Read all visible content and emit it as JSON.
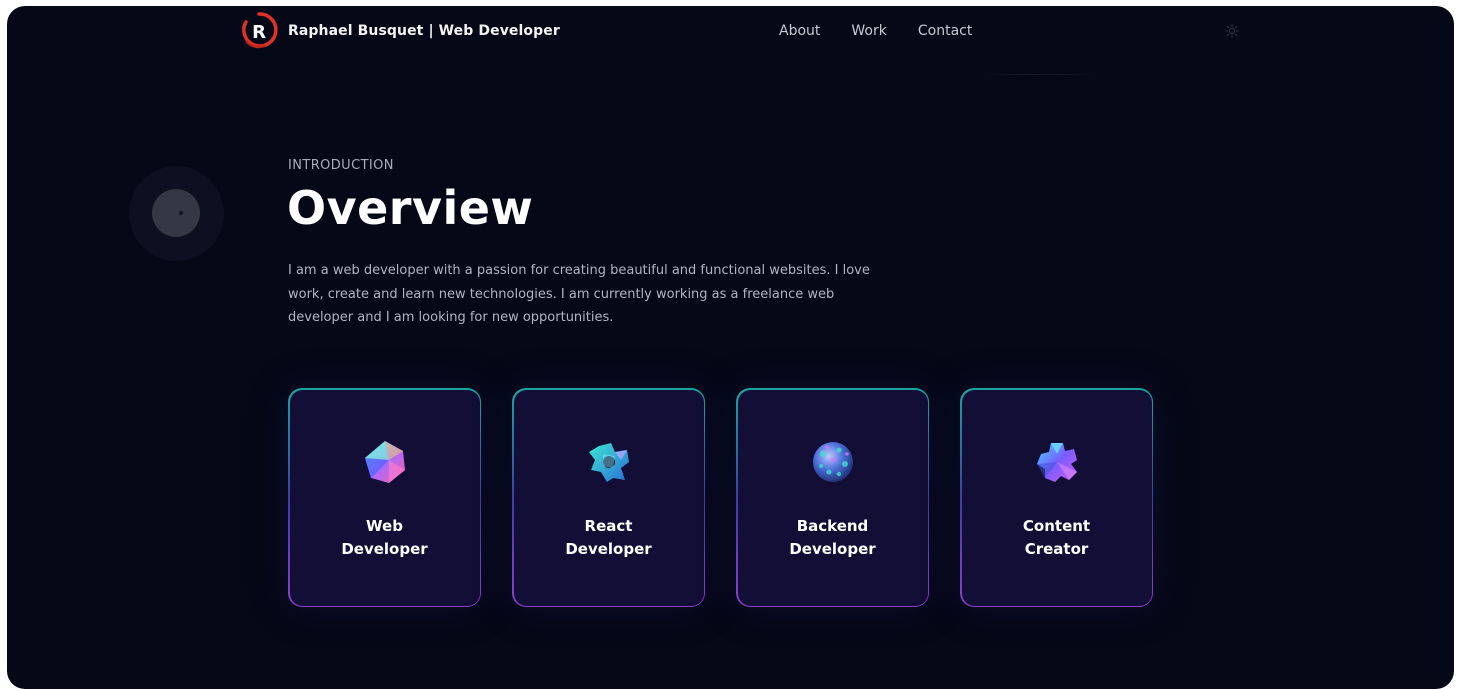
{
  "nav": {
    "brand": "Raphael Busquet | Web Developer",
    "logo_letter": "R",
    "links": [
      "About",
      "Work",
      "Contact"
    ]
  },
  "intro": {
    "eyebrow": "INTRODUCTION",
    "title": "Overview",
    "description": "I am a web developer with a passion for creating beautiful and functional websites. I love work, create and learn new technologies. I am currently working as a freelance web developer and I am looking for new opportunities."
  },
  "cards": [
    {
      "label": "Web\nDeveloper",
      "icon": "web-developer-icon"
    },
    {
      "label": "React\nDeveloper",
      "icon": "react-developer-icon"
    },
    {
      "label": "Backend\nDeveloper",
      "icon": "backend-developer-icon"
    },
    {
      "label": "Content\nCreator",
      "icon": "content-creator-icon"
    }
  ],
  "colors": {
    "background": "#050816",
    "card_background": "#130e36",
    "card_border_top": "#17a7a0",
    "card_border_bottom": "#8f3dd0",
    "logo_ring": "#e0312a"
  }
}
